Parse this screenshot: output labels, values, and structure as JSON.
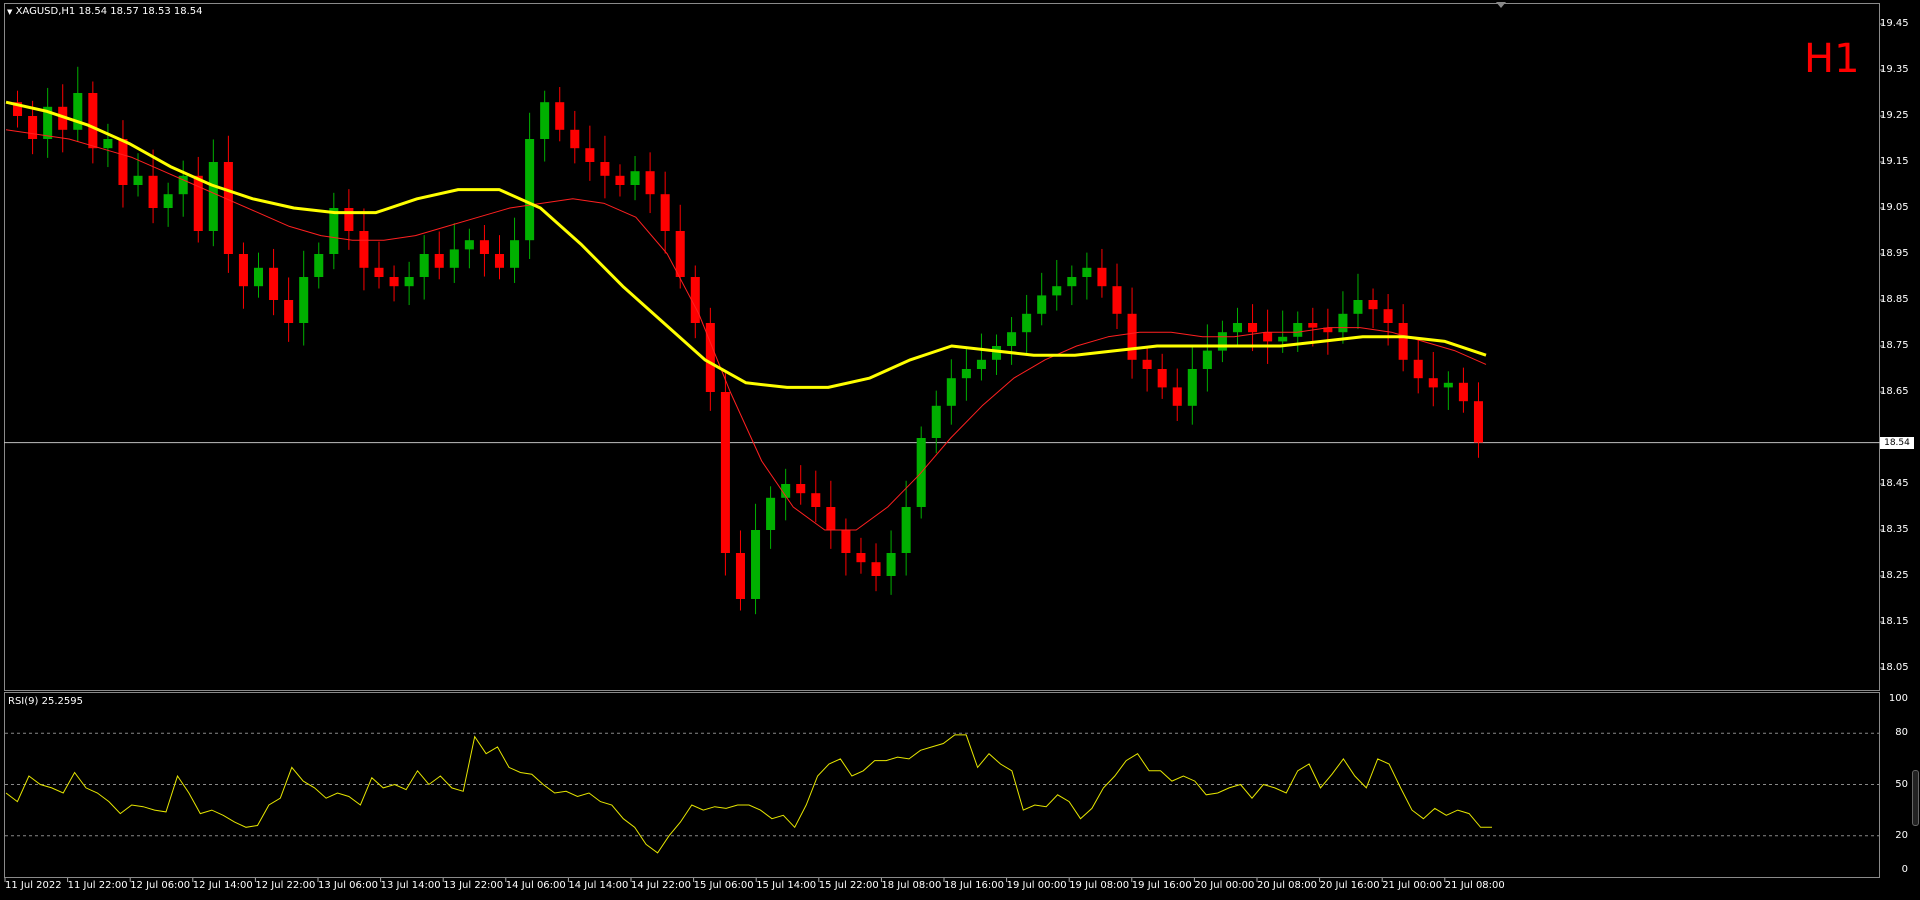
{
  "window": {
    "title": "XAGUSD,H1  18.54 18.57 18.53 18.54",
    "timeframe_badge": "H1",
    "bid_tag": "18.54"
  },
  "colors": {
    "bull": "#00b000",
    "bear": "#ff0000",
    "ma_slow": "#ffff00",
    "ma_fast": "#ff2020",
    "rsi": "#e6e600",
    "grid": "#888888"
  },
  "icons": {
    "title_menu": "triangle-down-icon",
    "scroll_handle": "scroll-handle-icon",
    "top_marker": "triangle-marker-icon"
  },
  "rsi_panel": {
    "title": "RSI(9) 25.2595"
  },
  "chart_data": [
    {
      "type": "candlestick",
      "title": "XAGUSD,H1",
      "ylim": [
        18.0,
        19.5
      ],
      "y_ticks": [
        "19.45",
        "19.35",
        "19.25",
        "19.15",
        "19.05",
        "18.95",
        "18.85",
        "18.75",
        "18.65",
        "18.54",
        "18.45",
        "18.35",
        "18.25",
        "18.15",
        "18.05"
      ],
      "x_ticks": [
        "11 Jul 2022",
        "11 Jul 22:00",
        "12 Jul 06:00",
        "12 Jul 14:00",
        "12 Jul 22:00",
        "13 Jul 06:00",
        "13 Jul 14:00",
        "13 Jul 22:00",
        "14 Jul 06:00",
        "14 Jul 14:00",
        "14 Jul 22:00",
        "15 Jul 06:00",
        "15 Jul 14:00",
        "15 Jul 22:00",
        "18 Jul 08:00",
        "18 Jul 16:00",
        "19 Jul 00:00",
        "19 Jul 08:00",
        "19 Jul 16:00",
        "20 Jul 00:00",
        "20 Jul 08:00",
        "20 Jul 16:00",
        "21 Jul 00:00",
        "21 Jul 08:00"
      ],
      "last_price": 18.54,
      "close_series": [
        19.25,
        19.2,
        19.27,
        19.22,
        19.3,
        19.18,
        19.2,
        19.1,
        19.12,
        19.05,
        19.08,
        19.12,
        19.0,
        19.15,
        18.95,
        18.88,
        18.92,
        18.85,
        18.8,
        18.9,
        18.95,
        19.05,
        19.0,
        18.92,
        18.9,
        18.88,
        18.9,
        18.95,
        18.92,
        18.96,
        18.98,
        18.95,
        18.92,
        18.98,
        19.2,
        19.28,
        19.22,
        19.18,
        19.15,
        19.12,
        19.1,
        19.13,
        19.08,
        19.0,
        18.9,
        18.8,
        18.65,
        18.3,
        18.2,
        18.35,
        18.42,
        18.45,
        18.43,
        18.4,
        18.35,
        18.3,
        18.28,
        18.25,
        18.3,
        18.4,
        18.55,
        18.62,
        18.68,
        18.7,
        18.72,
        18.75,
        18.78,
        18.82,
        18.86,
        18.88,
        18.9,
        18.92,
        18.88,
        18.82,
        18.72,
        18.7,
        18.66,
        18.62,
        18.7,
        18.74,
        18.78,
        18.8,
        18.78,
        18.76,
        18.77,
        18.8,
        18.79,
        18.78,
        18.82,
        18.85,
        18.83,
        18.8,
        18.72,
        18.68,
        18.66,
        18.67,
        18.63,
        18.54
      ],
      "series": [
        {
          "name": "MA fast",
          "values": [
            19.22,
            19.21,
            19.2,
            19.18,
            19.16,
            19.13,
            19.1,
            19.07,
            19.04,
            19.01,
            18.99,
            18.98,
            18.98,
            18.99,
            19.01,
            19.03,
            19.05,
            19.06,
            19.07,
            19.06,
            19.03,
            18.95,
            18.82,
            18.65,
            18.5,
            18.4,
            18.35,
            18.35,
            18.4,
            18.47,
            18.55,
            18.62,
            18.68,
            18.72,
            18.75,
            18.77,
            18.78,
            18.78,
            18.77,
            18.77,
            18.78,
            18.78,
            18.79,
            18.79,
            18.78,
            18.76,
            18.74,
            18.71
          ]
        },
        {
          "name": "MA slow",
          "values": [
            19.28,
            19.26,
            19.23,
            19.19,
            19.14,
            19.1,
            19.07,
            19.05,
            19.04,
            19.04,
            19.07,
            19.09,
            19.09,
            19.05,
            18.97,
            18.88,
            18.8,
            18.72,
            18.67,
            18.66,
            18.66,
            18.68,
            18.72,
            18.75,
            18.74,
            18.73,
            18.73,
            18.74,
            18.75,
            18.75,
            18.75,
            18.75,
            18.76,
            18.77,
            18.77,
            18.76,
            18.73
          ]
        }
      ]
    },
    {
      "type": "line",
      "title": "RSI(9) 25.2595",
      "ylim": [
        0,
        100
      ],
      "y_ticks": [
        "100",
        "80",
        "50",
        "20",
        "0"
      ],
      "levels": [
        80,
        50,
        20
      ],
      "values": [
        45,
        40,
        55,
        50,
        48,
        45,
        57,
        48,
        45,
        40,
        33,
        38,
        37,
        35,
        34,
        55,
        45,
        33,
        35,
        32,
        28,
        25,
        26,
        38,
        42,
        60,
        52,
        48,
        42,
        45,
        43,
        38,
        54,
        48,
        50,
        47,
        58,
        50,
        55,
        48,
        46,
        78,
        68,
        72,
        60,
        57,
        56,
        50,
        45,
        46,
        43,
        45,
        40,
        38,
        30,
        25,
        15,
        10,
        20,
        28,
        38,
        35,
        37,
        36,
        38,
        38,
        35,
        30,
        32,
        25,
        38,
        55,
        62,
        65,
        55,
        58,
        64,
        64,
        66,
        65,
        70,
        72,
        74,
        79,
        79,
        60,
        68,
        62,
        58,
        35,
        38,
        37,
        44,
        40,
        30,
        36,
        48,
        55,
        64,
        68,
        58,
        58,
        52,
        55,
        52,
        44,
        45,
        48,
        50,
        42,
        50,
        48,
        45,
        58,
        62,
        48,
        56,
        65,
        55,
        48,
        65,
        62,
        48,
        35,
        30,
        36,
        32,
        35,
        33,
        25,
        25
      ]
    }
  ]
}
